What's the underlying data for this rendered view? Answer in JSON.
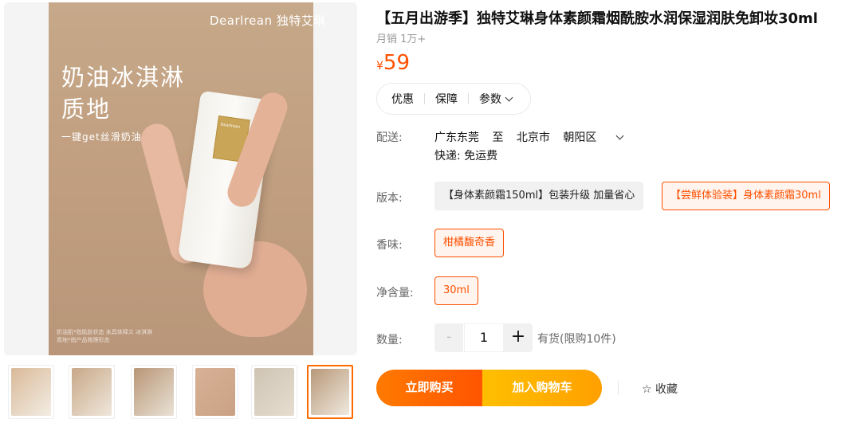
{
  "gallery": {
    "brand_watermark": "Dearlrean 独特艾琳",
    "promo_title_line1": "奶油冰淇淋",
    "promo_title_line2": "质地",
    "promo_subtitle": "一键get丝滑奶油肌*",
    "promo_footnote": "奶油肌*指肌肤状态 未具体释义 冰淇淋质地*指产品物理形态",
    "tube_brand": "Dearlrean",
    "thumbnails": [
      {
        "label": "thumbnail-1",
        "colors": [
          "#d9b998",
          "#f3ede4"
        ]
      },
      {
        "label": "thumbnail-2",
        "colors": [
          "#c8a887",
          "#efe7dc"
        ]
      },
      {
        "label": "thumbnail-3",
        "colors": [
          "#b99676",
          "#e9e2d6"
        ]
      },
      {
        "label": "thumbnail-4",
        "colors": [
          "#d7b196",
          "#caa184"
        ]
      },
      {
        "label": "thumbnail-5",
        "colors": [
          "#cfc4b4",
          "#e6ddd0"
        ]
      },
      {
        "label": "thumbnail-6",
        "colors": [
          "#b89878",
          "#efe9df"
        ]
      }
    ],
    "active_thumbnail": 5
  },
  "product": {
    "title": "【五月出游季】独特艾琳身体素颜霜烟酰胺水润保湿润肤免卸妆30ml",
    "sales": "月销 1万+",
    "price_symbol": "¥",
    "price": "59"
  },
  "tabs": [
    "优惠",
    "保障",
    "参数"
  ],
  "shipping": {
    "label": "配送:",
    "from": "广东东莞",
    "to_word": "至",
    "city": "北京市",
    "district": "朝阳区",
    "express": "快递: 免运费"
  },
  "version": {
    "label": "版本:",
    "options": [
      "【身体素颜霜150ml】包装升级 加量省心",
      "【尝鲜体验装】身体素颜霜30ml"
    ],
    "selected": 1
  },
  "scent": {
    "label": "香味:",
    "options": [
      "柑橘馥奇香"
    ],
    "selected": 0
  },
  "volume": {
    "label": "净含量:",
    "options": [
      "30ml"
    ],
    "selected": 0
  },
  "quantity": {
    "label": "数量:",
    "minus": "-",
    "value": "1",
    "plus": "+",
    "stock": "有货(限购10件)"
  },
  "actions": {
    "buy_now": "立即购买",
    "add_to_cart": "加入购物车",
    "favorite": "☆ 收藏"
  },
  "colors": {
    "accent": "#ff5000",
    "buy_gradient_start": "#ff7a00",
    "cart_gradient_start": "#ffbf00"
  }
}
